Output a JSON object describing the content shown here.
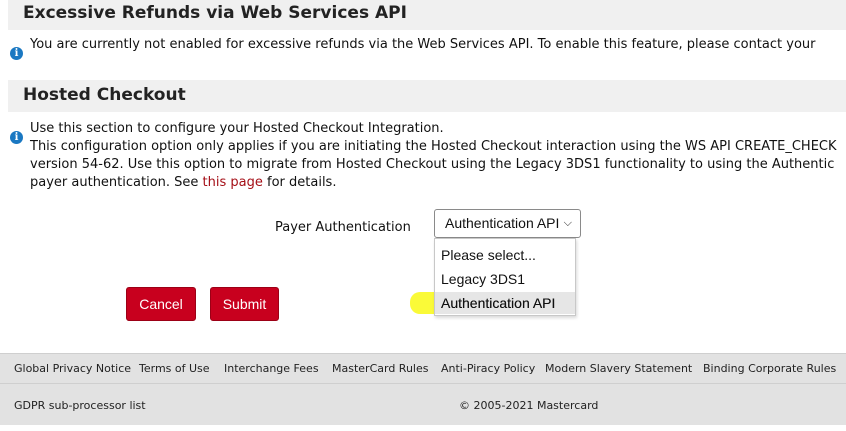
{
  "refunds": {
    "title": "Excessive Refunds via Web Services API",
    "message": "You are currently not enabled for excessive refunds via the Web Services API. To enable this feature, please contact your"
  },
  "hosted": {
    "title": "Hosted Checkout",
    "line1": "Use this section to configure your Hosted Checkout Integration.",
    "line2": "This configuration option only applies if you are initiating the Hosted Checkout interaction using the WS API CREATE_CHECK",
    "line3": "version 54-62. Use this option to migrate from Hosted Checkout using the Legacy 3DS1 functionality to using the Authentic",
    "line4_pre": "payer authentication. See ",
    "line4_link": "this page",
    "line4_post": " for details."
  },
  "payer_auth": {
    "label": "Payer Authentication",
    "selected": "Authentication API",
    "options": [
      "Please select...",
      "Legacy 3DS1",
      "Authentication API"
    ]
  },
  "buttons": {
    "cancel": "Cancel",
    "submit": "Submit"
  },
  "footer": {
    "links": [
      "Global Privacy Notice",
      "Terms of Use",
      "Interchange Fees",
      "MasterCard Rules",
      "Anti-Piracy Policy",
      "Modern Slavery Statement",
      "Binding Corporate Rules"
    ],
    "gdpr": "GDPR sub-processor list",
    "copyright": "© 2005-2021 Mastercard"
  },
  "colors": {
    "accent_red": "#c8001e",
    "link_red": "#a50f17",
    "info_blue": "#1a78c2",
    "highlight_yellow": "#fafa22"
  }
}
